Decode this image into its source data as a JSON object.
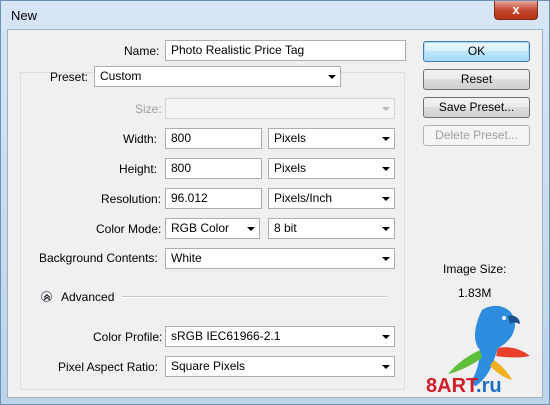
{
  "window": {
    "title": "New",
    "close_glyph": "x"
  },
  "fields": {
    "name": {
      "label": "Name:",
      "value": "Photo Realistic Price Tag"
    },
    "preset": {
      "label": "Preset:",
      "value": "Custom"
    },
    "size": {
      "label": "Size:",
      "value": ""
    },
    "width": {
      "label": "Width:",
      "value": "800",
      "unit": "Pixels"
    },
    "height": {
      "label": "Height:",
      "value": "800",
      "unit": "Pixels"
    },
    "resolution": {
      "label": "Resolution:",
      "value": "96.012",
      "unit": "Pixels/Inch"
    },
    "color_mode": {
      "label": "Color Mode:",
      "value": "RGB Color",
      "depth": "8 bit"
    },
    "background": {
      "label": "Background Contents:",
      "value": "White"
    },
    "advanced": {
      "label": "Advanced"
    },
    "color_profile": {
      "label": "Color Profile:",
      "value": "sRGB IEC61966-2.1"
    },
    "pixel_aspect": {
      "label": "Pixel Aspect Ratio:",
      "value": "Square Pixels"
    }
  },
  "buttons": {
    "ok": "OK",
    "reset": "Reset",
    "save_preset": "Save Preset...",
    "delete_preset": "Delete Preset..."
  },
  "image_size": {
    "label": "Image Size:",
    "value": "1.83M"
  },
  "watermark": {
    "brand": "8ART",
    "tld": ".ru"
  },
  "icons": {
    "close": "close-icon",
    "dropdown": "chevron-down-icon",
    "advanced": "chevron-up-circle-icon",
    "logo": "parrot-logo"
  }
}
